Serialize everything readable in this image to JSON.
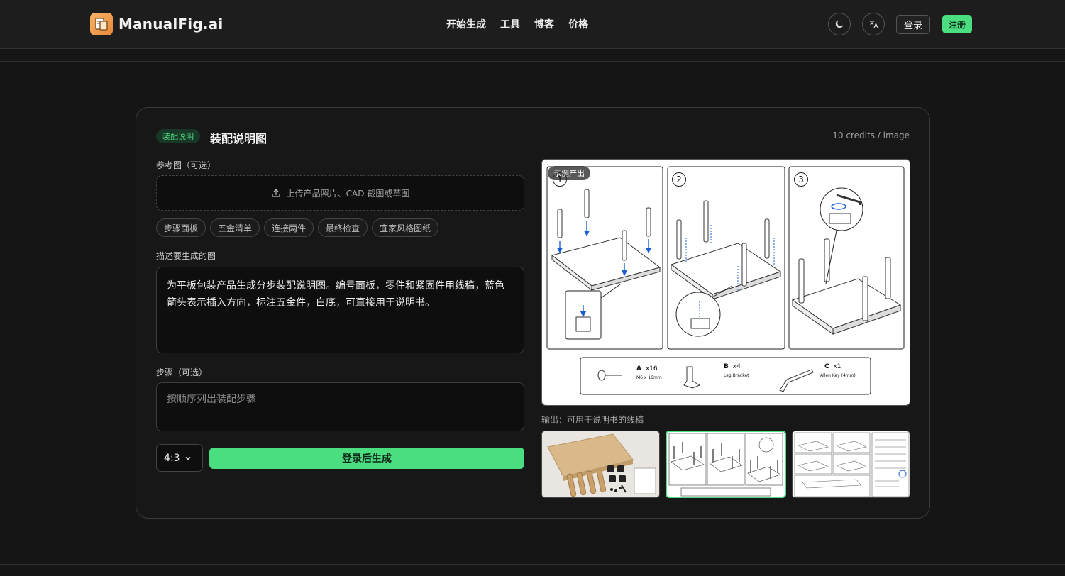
{
  "header": {
    "brand": "ManualFig.ai",
    "nav": [
      "开始生成",
      "工具",
      "博客",
      "价格"
    ],
    "login": "登录",
    "signup": "注册",
    "icons": [
      "moon-icon",
      "translate-icon"
    ]
  },
  "card": {
    "badge": "装配说明",
    "title": "装配说明图",
    "credits": "10 credits / image",
    "reference_label": "参考图（可选）",
    "upload_text": "上传产品照片、CAD 截图或草图",
    "chips": [
      "步骤面板",
      "五金清单",
      "连接两件",
      "最终检查",
      "宜家风格图纸"
    ],
    "describe_label": "描述要生成的图",
    "describe_value": "为平板包装产品生成分步装配说明图。编号面板，零件和紧固件用线稿，蓝色箭头表示插入方向，标注五金件，白底，可直接用于说明书。",
    "steps_label": "步骤（可选）",
    "steps_placeholder": "按顺序列出装配步骤",
    "ratio": "4:3",
    "generate": "登录后生成"
  },
  "preview": {
    "tag": "示例产出",
    "steps": [
      "1",
      "2",
      "3"
    ],
    "parts": [
      {
        "letter": "A",
        "qty": "x16",
        "name": "M6 x 16mm"
      },
      {
        "letter": "B",
        "qty": "x4",
        "name": "Leg Bracket"
      },
      {
        "letter": "C",
        "qty": "x1",
        "name": "Allen Key (4mm)"
      }
    ],
    "output_label": "输出：可用于说明书的线稿"
  },
  "colors": {
    "accent": "#4ade80",
    "background": "#151515",
    "arrow": "#1a5fd1"
  }
}
